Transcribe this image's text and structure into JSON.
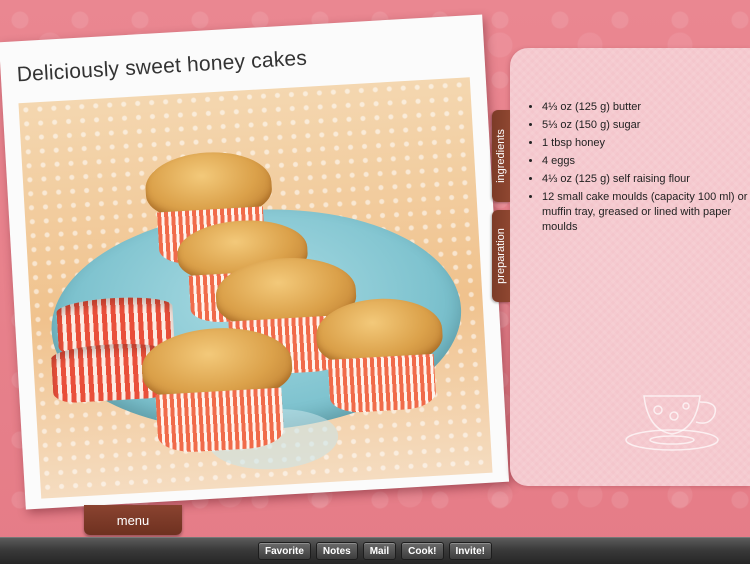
{
  "recipe": {
    "title": "Deliciously sweet honey cakes"
  },
  "tabs": {
    "ingredients": "ingredients",
    "preparation": "preparation"
  },
  "ingredients": [
    "4⅓ oz (125 g) butter",
    "5⅓ oz (150 g) sugar",
    "1 tbsp honey",
    "4 eggs",
    "4⅓ oz (125 g) self raising flour",
    "12 small cake moulds (capacity 100 ml) or muffin tray, greased or lined with paper moulds"
  ],
  "menu": {
    "label": "menu"
  },
  "toolbar": {
    "favorite": "Favorite",
    "notes": "Notes",
    "mail": "Mail",
    "cook": "Cook!",
    "invite": "Invite!"
  },
  "colors": {
    "background": "#e9848d",
    "panel": "#f4c6cc",
    "tab": "#8a4330",
    "toolbar": "#3a3a3a"
  }
}
